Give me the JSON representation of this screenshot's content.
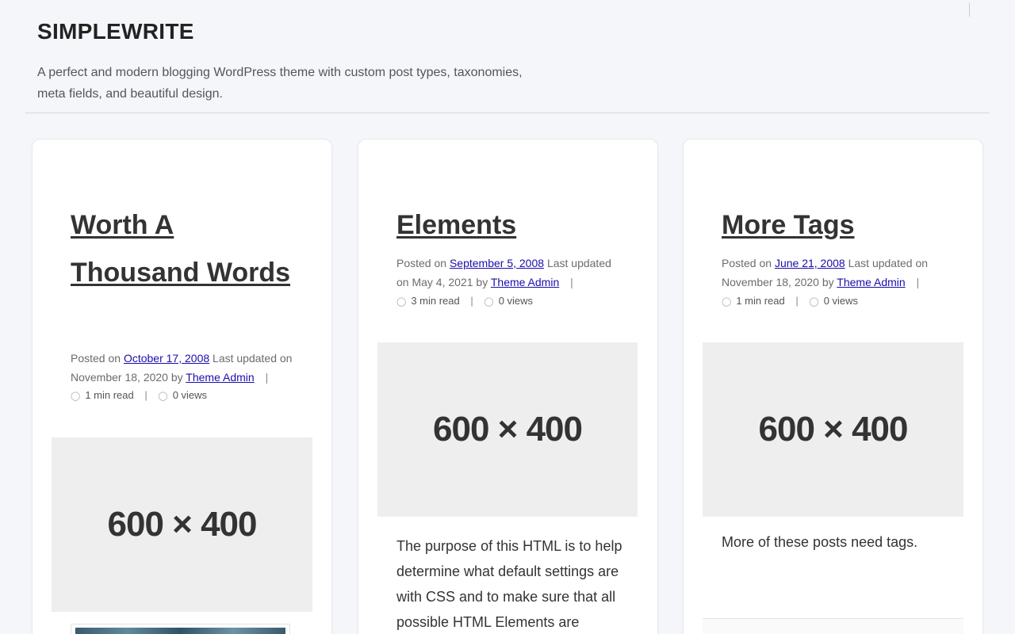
{
  "site": {
    "title": "SIMPLEWRITE",
    "description": "A perfect and modern blogging WordPress theme with custom post types, taxonomies, meta fields, and beautiful design."
  },
  "posts": [
    {
      "title": "Worth A Thousand Words",
      "posted_prefix": "Posted on",
      "posted_date": "October 17, 2008",
      "updated_prefix": "Last updated on",
      "updated_date": "November 18, 2020",
      "by": "by",
      "author": "Theme Admin",
      "read_time": "1 min read",
      "views": "0 views",
      "thumbnail_text": "600 × 400",
      "excerpt": ""
    },
    {
      "title": "Elements",
      "posted_prefix": "Posted on",
      "posted_date": "September 5, 2008",
      "updated_prefix": "Last updated on",
      "updated_date": "May 4, 2021",
      "by": "by",
      "author": "Theme Admin",
      "read_time": "3 min read",
      "views": "0 views",
      "thumbnail_text": "600 × 400",
      "excerpt": "The purpose of this HTML is to help determine what default settings are with CSS and to make sure that all possible HTML Elements are"
    },
    {
      "title": "More Tags",
      "posted_prefix": "Posted on",
      "posted_date": "June 21, 2008",
      "updated_prefix": "Last updated on",
      "updated_date": "November 18, 2020",
      "by": "by",
      "author": "Theme Admin",
      "read_time": "1 min read",
      "views": "0 views",
      "thumbnail_text": "600 × 400",
      "excerpt": "More of these posts need tags."
    }
  ],
  "icons": {
    "clock": "clock-icon",
    "eye": "eye-icon"
  }
}
